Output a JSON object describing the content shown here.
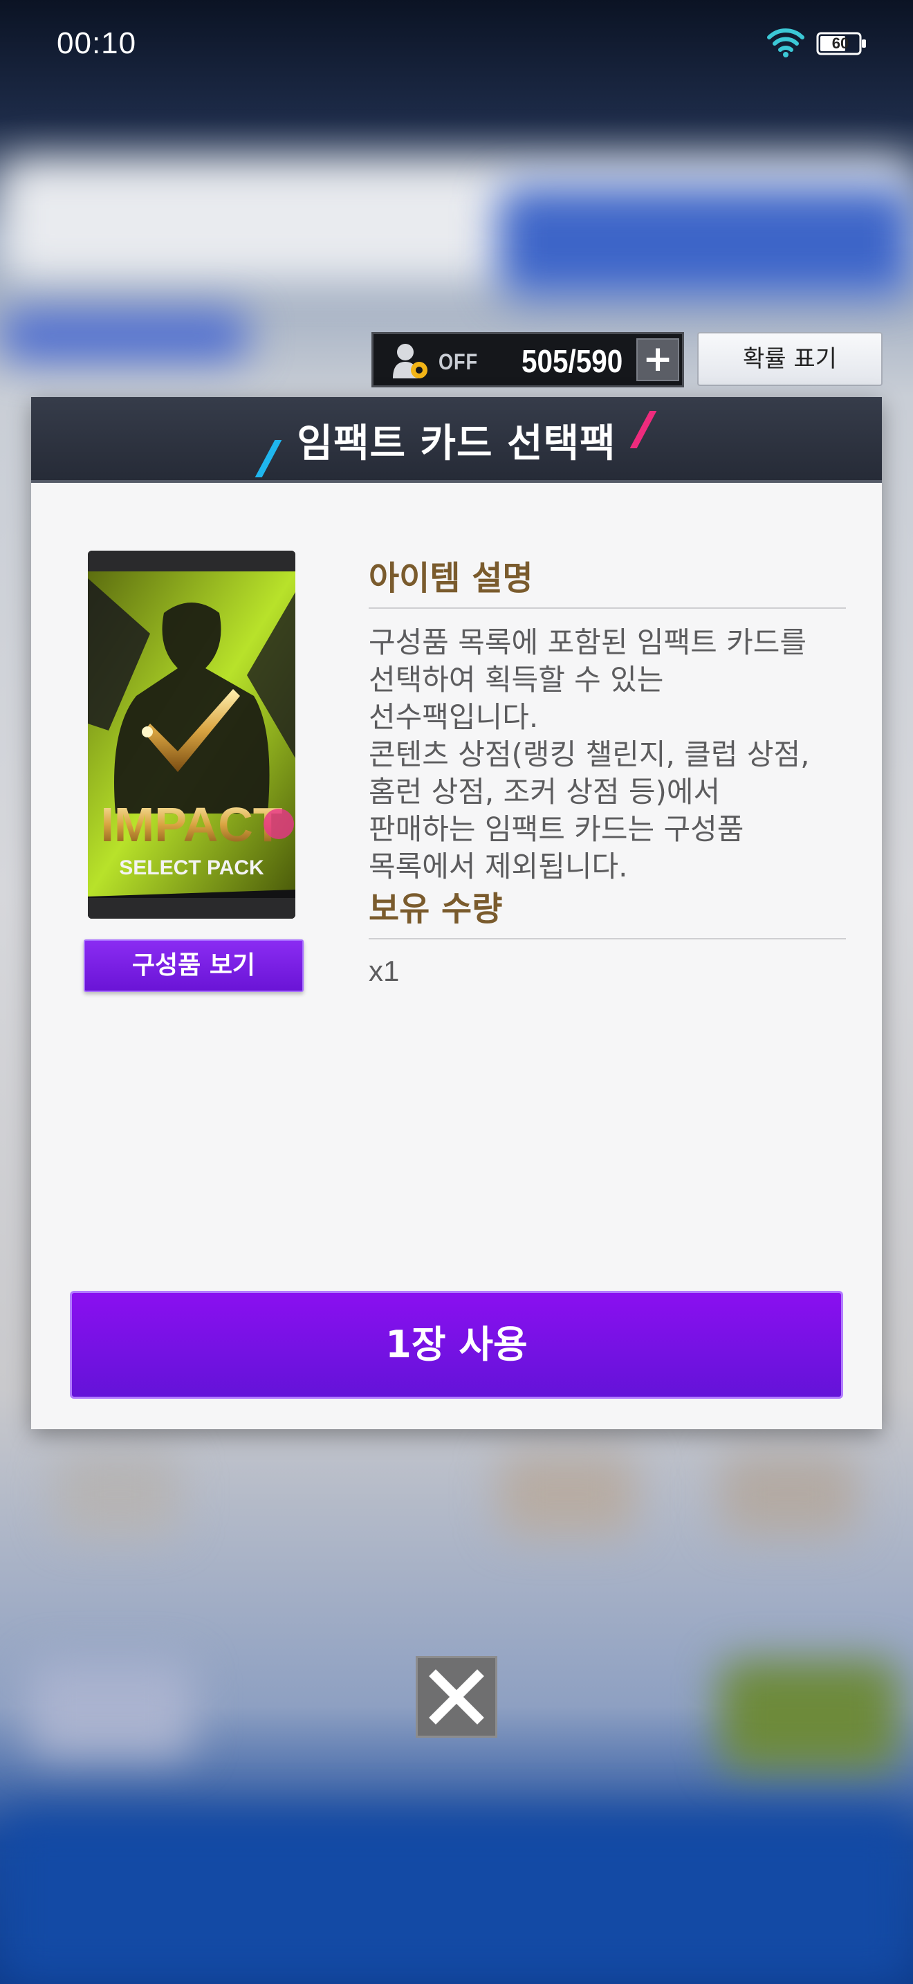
{
  "status_bar": {
    "time": "00:10",
    "battery": "60",
    "wifi_icon": "wifi-icon",
    "battery_icon": "battery-icon"
  },
  "currency": {
    "auto_label": "OFF",
    "count": "505/590",
    "plus": "+",
    "odds_button": "확률 표기"
  },
  "dialog": {
    "title": "임팩트 카드 선택팩",
    "pack": {
      "brand": "IMPACT",
      "subtitle": "SELECT PACK",
      "view_button": "구성품 보기"
    },
    "description_title": "아이템 설명",
    "description": "구성품 목록에 포함된 임팩트 카드를\n선택하여 획득할 수 있는\n선수팩입니다.\n콘텐츠 상점(랭킹 챌린지, 클럽 상점,\n홈런 상점, 조커 상점 등)에서\n판매하는 임팩트 카드는 구성품\n목록에서 제외됩니다.",
    "quantity_title": "보유 수량",
    "quantity": "x1",
    "use_button": "1장 사용"
  },
  "colors": {
    "accent_purple": "#7a12e6",
    "header_dark": "#2b303c",
    "section_title": "#7a5b2d",
    "slash_blue": "#1fb6ee",
    "slash_pink": "#ee2b7d"
  }
}
